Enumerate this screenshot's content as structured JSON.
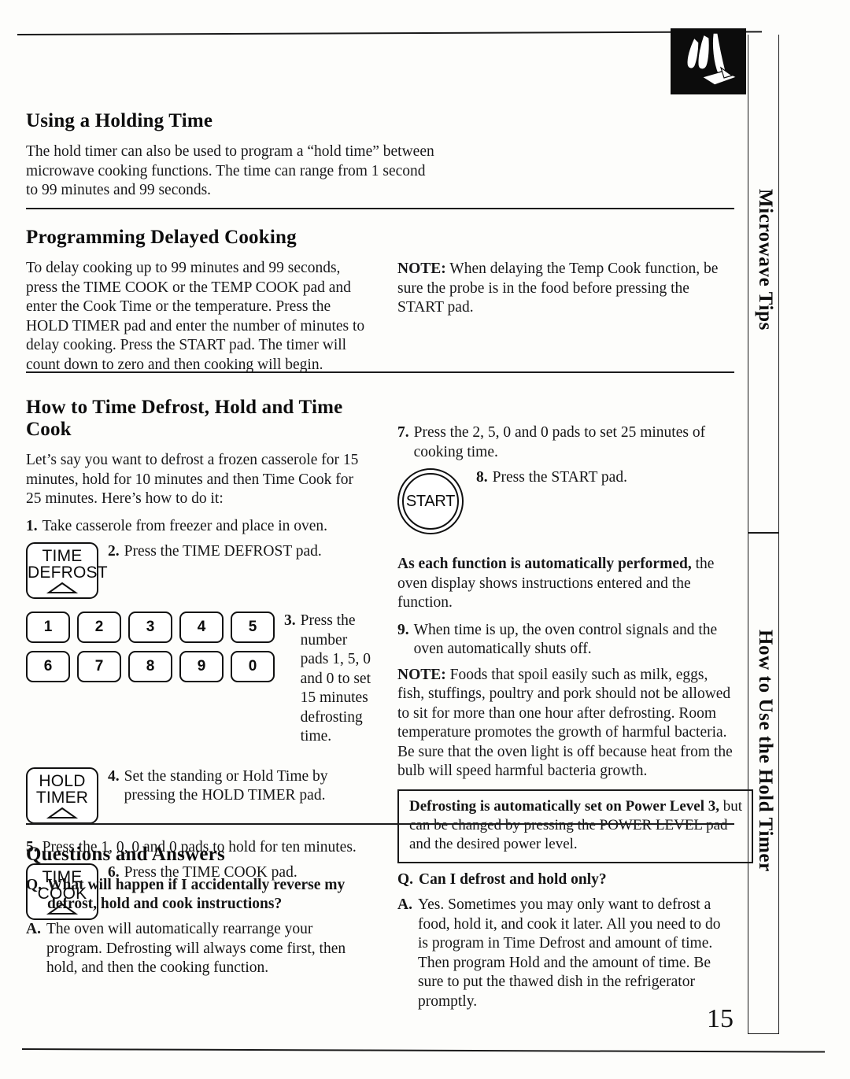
{
  "page": {
    "number": "15",
    "tabs": {
      "upper": "Microwave Tips",
      "lower": "How to Use the Hold Timer"
    },
    "corner_icon": "hand-pressing-pad-icon"
  },
  "sections": {
    "holding_time": {
      "heading": "Using a Holding Time",
      "body": "The hold timer can also be used to program a “hold time” between microwave cooking functions. The time can range from 1 second to 99 minutes and 99 seconds."
    },
    "delayed_cooking": {
      "heading": "Programming Delayed Cooking",
      "body": "To delay cooking up to 99 minutes and 99 seconds, press the TIME COOK or the TEMP COOK pad and enter the Cook Time or the temperature. Press the HOLD TIMER pad and enter the number of minutes to delay cooking. Press the START pad. The timer will count down to zero and then cooking will begin.",
      "note_label": "NOTE:",
      "note_body": " When delaying the Temp Cook function, be sure the probe is in the food before pressing the START pad."
    },
    "how_to": {
      "heading": "How to Time Defrost, Hold and Time Cook",
      "intro": "Let’s say you want to defrost a frozen casserole for 15 minutes, hold for 10 minutes and then Time Cook for 25 minutes. Here’s how to do it:",
      "steps": [
        {
          "num": "1.",
          "text": "Take casserole from freezer and place in oven."
        },
        {
          "num": "2.",
          "text": "Press the TIME DEFROST pad."
        },
        {
          "num": "3.",
          "text": "Press the number pads 1, 5, 0 and 0 to set 15 minutes defrosting time."
        },
        {
          "num": "4.",
          "text": "Set the standing or Hold Time by pressing the HOLD TIMER pad."
        },
        {
          "num": "5.",
          "text": "Press the 1, 0, 0 and 0 pads to hold for ten minutes."
        },
        {
          "num": "6.",
          "text": "Press the TIME COOK pad."
        },
        {
          "num": "7.",
          "text": "Press the 2, 5, 0 and 0 pads to set 25 minutes of cooking time."
        },
        {
          "num": "8.",
          "text": "Press the START pad."
        },
        {
          "num": "9.",
          "text": "When time is up, the oven control signals and the oven automatically shuts off."
        }
      ],
      "auto_label": "As each function is automatically performed,",
      "auto_body": " the oven display shows instructions entered and the function.",
      "note_label": "NOTE:",
      "note_body": " Foods that spoil easily such as milk, eggs, fish, stuffings, poultry and pork should not be allowed to sit for more than one hour after defrosting. Room temperature promotes the growth of harmful bacteria. Be sure that the oven light is off because heat from the bulb will speed harmful bacteria growth.",
      "callout_bold": "Defrosting is automatically set on Power Level 3,",
      "callout_rest": " but can be changed by pressing the POWER LEVEL pad and the desired power level."
    },
    "qa": {
      "heading": "Questions and Answers",
      "items": [
        {
          "q_mark": "Q.",
          "question": "What will happen if I accidentally reverse my defrost, hold and cook instructions?",
          "a_mark": "A.",
          "answer": "The oven will automatically rearrange your program. Defrosting will always come first, then hold, and then the cooking function."
        },
        {
          "q_mark": "Q.",
          "question": "Can I defrost and hold only?",
          "a_mark": "A.",
          "answer": "Yes. Sometimes you may only want to defrost a food, hold it, and cook it later. All you need to do is program in Time Defrost and amount of time. Then program Hold and the amount of time. Be sure to put the thawed dish in the refrigerator promptly."
        }
      ]
    }
  },
  "pads": {
    "time_defrost": {
      "line1": "TIME",
      "line2": "DEFROST"
    },
    "hold_timer": {
      "line1": "HOLD",
      "line2": "TIMER"
    },
    "time_cook": {
      "line1": "TIME",
      "line2": "COOK"
    },
    "start": "START",
    "number_row_1": [
      "1",
      "2",
      "3",
      "4",
      "5"
    ],
    "number_row_2": [
      "6",
      "7",
      "8",
      "9",
      "0"
    ]
  }
}
